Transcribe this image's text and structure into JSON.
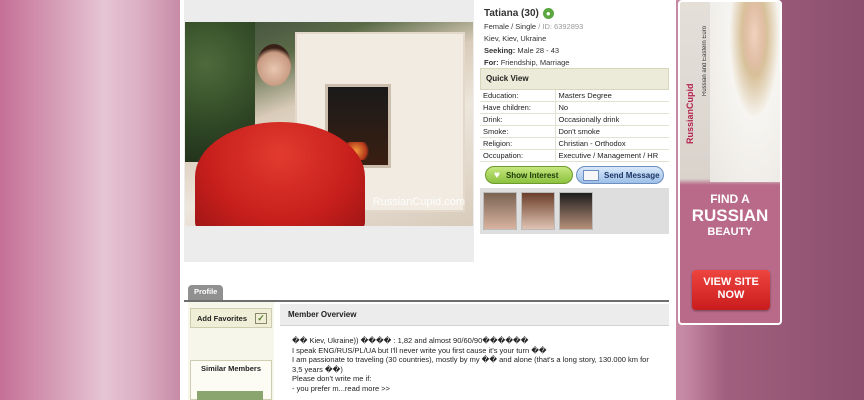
{
  "profile": {
    "name": "Tatiana (30)",
    "online_icon": "online-icon",
    "gender_status": "Female / Single",
    "id_text": "/ ID: 6392893",
    "location": "Kiev, Kiev, Ukraine",
    "seeking_label": "Seeking:",
    "seeking_value": "Male 28 - 43",
    "for_label": "For:",
    "for_value": "Friendship, Marriage",
    "photo_watermark": "RussianCupid.com"
  },
  "quick_view": {
    "title": "Quick View",
    "rows": [
      {
        "label": "Education:",
        "value": "Masters Degree"
      },
      {
        "label": "Have children:",
        "value": "No"
      },
      {
        "label": "Drink:",
        "value": "Occasionally drink"
      },
      {
        "label": "Smoke:",
        "value": "Don't smoke"
      },
      {
        "label": "Religion:",
        "value": "Christian - Orthodox"
      },
      {
        "label": "Occupation:",
        "value": "Executive / Management / HR"
      }
    ]
  },
  "actions": {
    "show_interest": "Show Interest",
    "send_message": "Send Message"
  },
  "tabs": {
    "profile": "Profile"
  },
  "sidebar": {
    "add_favorites": "Add Favorites",
    "similar_members": "Similar Members"
  },
  "overview": {
    "title": "Member Overview",
    "lines": [
      "�� Kiev, Ukraine)) ���� : 1,82 and almost 90/60/90������",
      "I speak ENG/RUS/PL/UA but I'll never write you first cause it's your turn ��",
      "I am passionate to traveling (30 countries), mostly by my �� and alone (that's a long story, 130.000 km for 3,5 years ��)",
      "Please don't write me if:",
      "- you prefer m...read more >>"
    ]
  },
  "ad": {
    "brand": "RussianCupid",
    "tagline": "Russian and Eastern Euro",
    "headline_1": "FIND A",
    "headline_2": "RUSSIAN",
    "headline_3": "BEAUTY",
    "cta": "VIEW SITE NOW"
  }
}
